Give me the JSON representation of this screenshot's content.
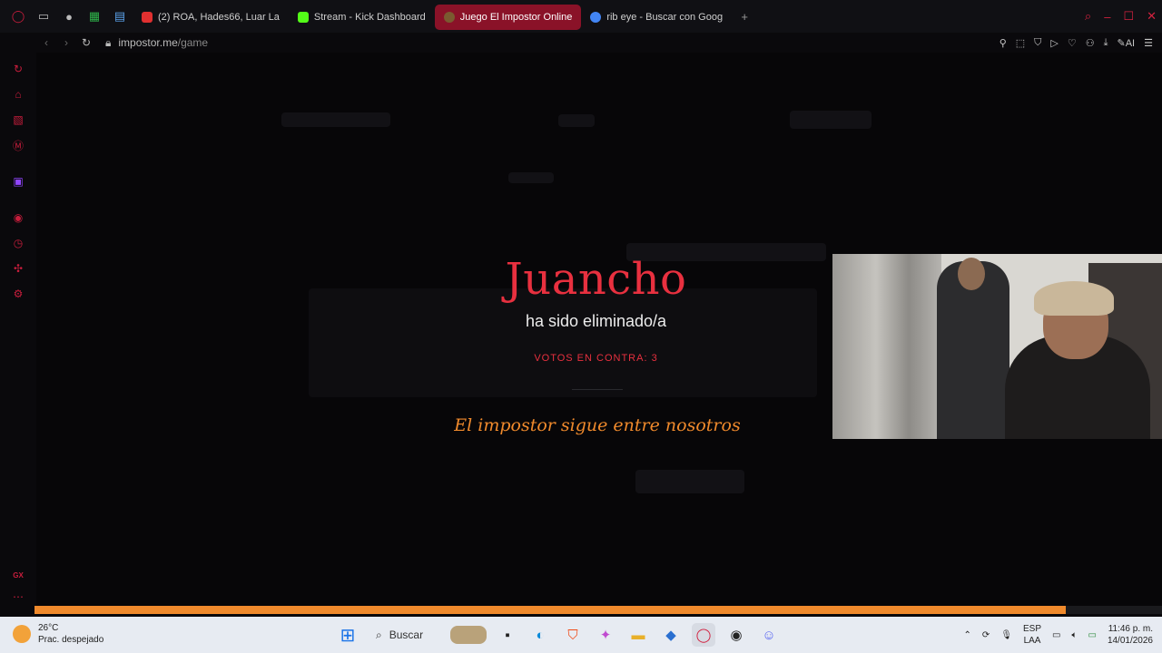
{
  "browser": {
    "tabs": [
      {
        "label": "(2) ROA, Hades66, Luar La",
        "color": "#e03030",
        "active": false
      },
      {
        "label": "Stream - Kick Dashboard",
        "color": "#53fc18",
        "active": false
      },
      {
        "label": "Juego El Impostor Online",
        "color": "#7a5a30",
        "active": true
      },
      {
        "label": "rib eye - Buscar con Goog",
        "color": "#4285f4",
        "active": false
      }
    ],
    "new_tab_icon": "plus-icon",
    "url_host": "impostor.me",
    "url_path": "/game",
    "ai_label": "AI"
  },
  "game": {
    "player_name": "Juancho",
    "eliminated_text": "ha sido eliminado/a",
    "votes_text": "VOTOS EN CONTRA: 3",
    "impostor_message": "El impostor sigue entre nosotros",
    "progress_fraction": 0.915
  },
  "colors": {
    "accent": "#e8303f",
    "message": "#f08a2c",
    "opera_red": "#c81d3c"
  },
  "taskbar": {
    "weather_temp": "26°C",
    "weather_desc": "Prac. despejado",
    "search_placeholder": "Buscar",
    "lang_top": "ESP",
    "lang_bottom": "LAA",
    "time": "11:46 p. m.",
    "date": "14/01/2026"
  },
  "sidebar_gx_label": "GX"
}
